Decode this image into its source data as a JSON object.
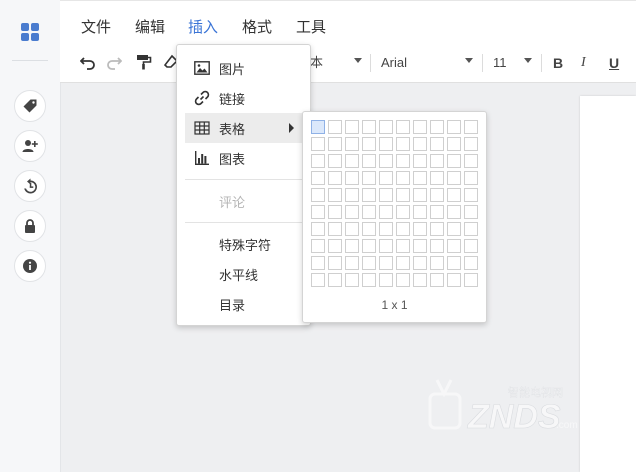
{
  "menubar": {
    "items": [
      {
        "label": "文件"
      },
      {
        "label": "编辑"
      },
      {
        "label": "插入",
        "active": true
      },
      {
        "label": "格式"
      },
      {
        "label": "工具"
      }
    ]
  },
  "toolbar": {
    "font_style_tail": "本",
    "font_family": "Arial",
    "font_size": "11",
    "bold": "B",
    "italic": "I",
    "underline": "U"
  },
  "insert_menu": {
    "items": [
      {
        "label": "图片",
        "icon": "image-icon"
      },
      {
        "label": "链接",
        "icon": "link-icon"
      },
      {
        "label": "表格",
        "icon": "table-icon",
        "highlighted": true,
        "has_submenu": true
      },
      {
        "label": "图表",
        "icon": "chart-icon"
      },
      {
        "label": "评论",
        "disabled": true
      },
      {
        "label": "特殊字符"
      },
      {
        "label": "水平线"
      },
      {
        "label": "目录"
      }
    ]
  },
  "table_picker": {
    "rows": 10,
    "cols": 10,
    "selected_rows": 1,
    "selected_cols": 1,
    "size_label": "1 x 1"
  },
  "watermark": {
    "brand": "ZNDS",
    "cn": "智能电视网",
    "suffix": ".com"
  },
  "colors": {
    "accent": "#3a74d6",
    "rail_bg": "#f6f7f9",
    "canvas_bg": "#eeeff1",
    "grid_selected": "#dbe8fb"
  }
}
